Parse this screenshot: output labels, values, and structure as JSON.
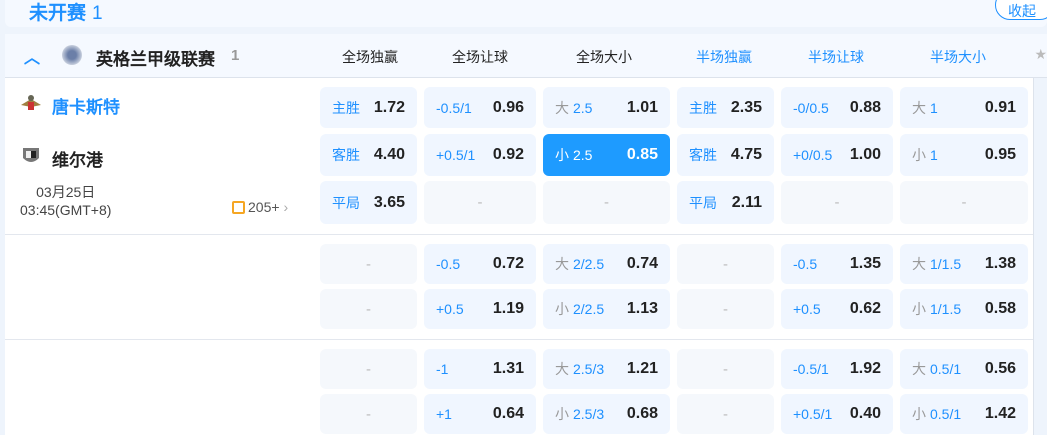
{
  "section": {
    "title": "未开赛",
    "count": "1",
    "collapse_label": "收起"
  },
  "league": {
    "name": "英格兰甲级联赛",
    "count": "1",
    "markets": [
      {
        "label": "全场独赢",
        "color": "#222222"
      },
      {
        "label": "全场让球",
        "color": "#222222"
      },
      {
        "label": "全场大小",
        "color": "#222222"
      },
      {
        "label": "半场独赢",
        "color": "#1e90ff"
      },
      {
        "label": "半场让球",
        "color": "#1e90ff"
      },
      {
        "label": "半场大小",
        "color": "#1e90ff"
      }
    ]
  },
  "match": {
    "home": "唐卡斯特",
    "away": "维尔港",
    "date": "03月25日",
    "time": "03:45(GMT+8)",
    "more": "205+",
    "home_color": "#1e90ff"
  },
  "rows": [
    [
      [
        "主胜",
        "",
        "1.72"
      ],
      [
        "-0.5/1",
        "",
        "0.96"
      ],
      [
        "大",
        "2.5",
        "1.01"
      ],
      [
        "主胜",
        "",
        "2.35"
      ],
      [
        "-0/0.5",
        "",
        "0.88"
      ],
      [
        "大",
        "1",
        "0.91"
      ]
    ],
    [
      [
        "客胜",
        "",
        "4.40"
      ],
      [
        "+0.5/1",
        "",
        "0.92"
      ],
      [
        "小",
        "2.5",
        "0.85",
        "selected"
      ],
      [
        "客胜",
        "",
        "4.75"
      ],
      [
        "+0/0.5",
        "",
        "1.00"
      ],
      [
        "小",
        "1",
        "0.95"
      ]
    ],
    [
      [
        "平局",
        "",
        "3.65"
      ],
      null,
      null,
      [
        "平局",
        "",
        "2.11"
      ],
      null,
      null
    ],
    [
      null,
      [
        "-0.5",
        "",
        "0.72"
      ],
      [
        "大",
        "2/2.5",
        "0.74"
      ],
      null,
      [
        "-0.5",
        "",
        "1.35"
      ],
      [
        "大",
        "1/1.5",
        "1.38"
      ]
    ],
    [
      null,
      [
        "+0.5",
        "",
        "1.19"
      ],
      [
        "小",
        "2/2.5",
        "1.13"
      ],
      null,
      [
        "+0.5",
        "",
        "0.62"
      ],
      [
        "小",
        "1/1.5",
        "0.58"
      ]
    ],
    [
      null,
      [
        "-1",
        "",
        "1.31"
      ],
      [
        "大",
        "2.5/3",
        "1.21"
      ],
      null,
      [
        "-0.5/1",
        "",
        "1.92"
      ],
      [
        "大",
        "0.5/1",
        "0.56"
      ]
    ],
    [
      null,
      [
        "+1",
        "",
        "0.64"
      ],
      [
        "小",
        "2.5/3",
        "0.68"
      ],
      null,
      [
        "+0.5/1",
        "",
        "0.40"
      ],
      [
        "小",
        "0.5/1",
        "1.42"
      ]
    ]
  ],
  "dash": "-"
}
